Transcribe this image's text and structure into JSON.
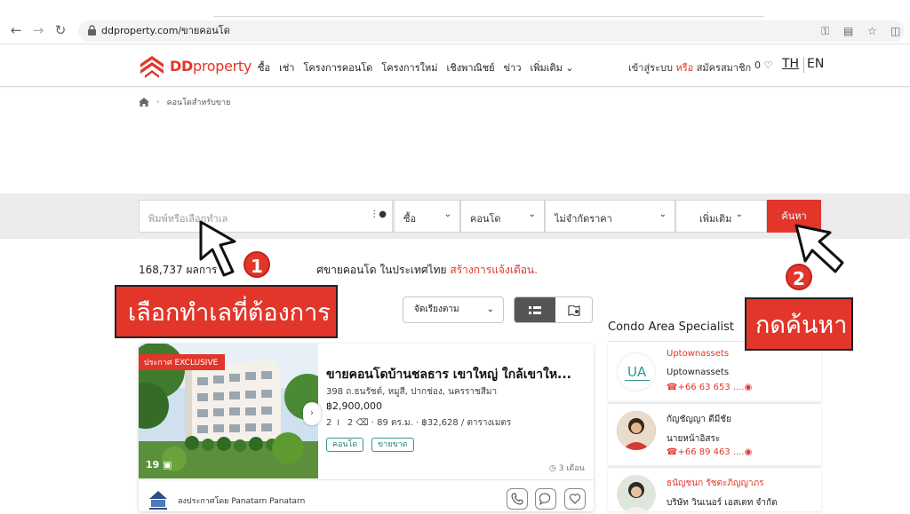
{
  "browser": {
    "url": "ddproperty.com/ขายคอนโด"
  },
  "header": {
    "logo_text_bold": "DD",
    "logo_text_light": "property",
    "nav": [
      "ซื้อ",
      "เช่า",
      "โครงการคอนโด",
      "โครงการใหม่",
      "เชิงพาณิชย์",
      "ข่าว",
      "เพิ่มเติม"
    ],
    "login": "เข้าสู่ระบบ",
    "or": "หรือ",
    "register": "สมัครสมาชิก",
    "favorites_count": "0",
    "lang_th": "TH",
    "lang_en": "EN"
  },
  "breadcrumb": {
    "current": "คอนโดสำหรับขาย"
  },
  "search": {
    "placeholder": "พิมพ์หรือเลือกทำเล",
    "listing_type": "ซื้อ",
    "property_type": "คอนโด",
    "price": "ไม่จำกัดราคา",
    "more": "เพิ่มเติม",
    "submit": "ค้นหา"
  },
  "results": {
    "count_text": "168,737 ผลการ...ค้นหา...ประกาศขายคอนโด ในประเทศไทย",
    "count_prefix": "168,737 ผลการ",
    "count_suffix": "ศขายคอนโด ในประเทศไทย",
    "alert_link": "สร้างการแจ้งเตือน.",
    "sort_label": "จัดเรียงตาม"
  },
  "listing": {
    "badge": "ประกาศ EXCLUSIVE",
    "photo_count": "19",
    "title": "ขายคอนโดบ้านชลธาร เขาใหญ่ ใกล้เขาให...",
    "address": "398 ถ.ธนรัชต์, หมูสี, ปากช่อง, นครราชสีมา",
    "price": "฿2,900,000",
    "beds": "2",
    "baths": "2",
    "area": "89 ตร.ม.",
    "price_per_area": "฿32,628 / ตารางเมตร",
    "tags": [
      "คอนโด",
      "ขายขาด"
    ],
    "age": "3 เดือน",
    "agent_prefix": "ลงประกาศโดย",
    "agent_name": "Panatarn Panatarn"
  },
  "sidebar": {
    "title": "Condo Area Specialist",
    "agents": [
      {
        "name": "Uptownassets",
        "company": "Uptownassets",
        "phone": "+66 63 653 ...."
      },
      {
        "name": "กัญชัญญา ดีมีชัย",
        "company": "นายหน้าอิสระ",
        "phone": "+66 89 463 ...."
      },
      {
        "name": "ธนัญชนก รัชตะภิญญาภร",
        "company": "บริษัท วินเนอร์ เอสเตท จำกัด",
        "phone": ""
      }
    ]
  },
  "annotations": {
    "callout_1": "เลือกทำเลที่ต้องการ",
    "callout_2": "กดค้นหา",
    "step_1": "1",
    "step_2": "2"
  },
  "colors": {
    "brand_red": "#e2362b",
    "tag_teal": "#2e9a8b"
  }
}
